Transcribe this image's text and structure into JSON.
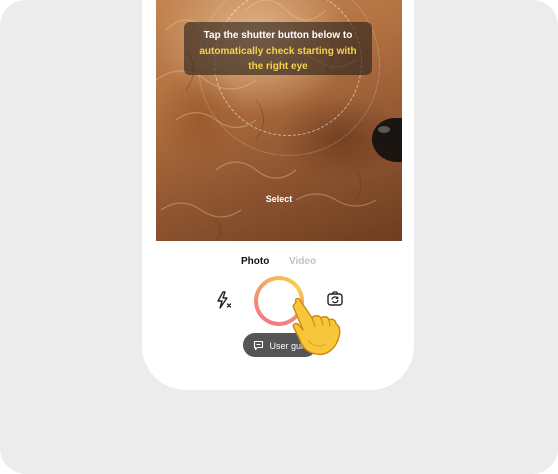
{
  "camera": {
    "hint_line1": "Tap the shutter button below to",
    "hint_line2": "automatically check starting with",
    "hint_line3": "the right eye",
    "select_label": "Select"
  },
  "modes": {
    "photo": "Photo",
    "video": "Video",
    "active": "Photo"
  },
  "controls": {
    "flash_icon": "flash-off-icon",
    "flip_icon": "flip-camera-icon",
    "guide_label": "User guide"
  },
  "colors": {
    "highlight_text": "#f5d547",
    "shutter_gradient_start": "#f2788c",
    "shutter_gradient_end": "#f8cf4d",
    "inactive_tab": "#c2c2c2",
    "guide_bg": "#555555"
  }
}
